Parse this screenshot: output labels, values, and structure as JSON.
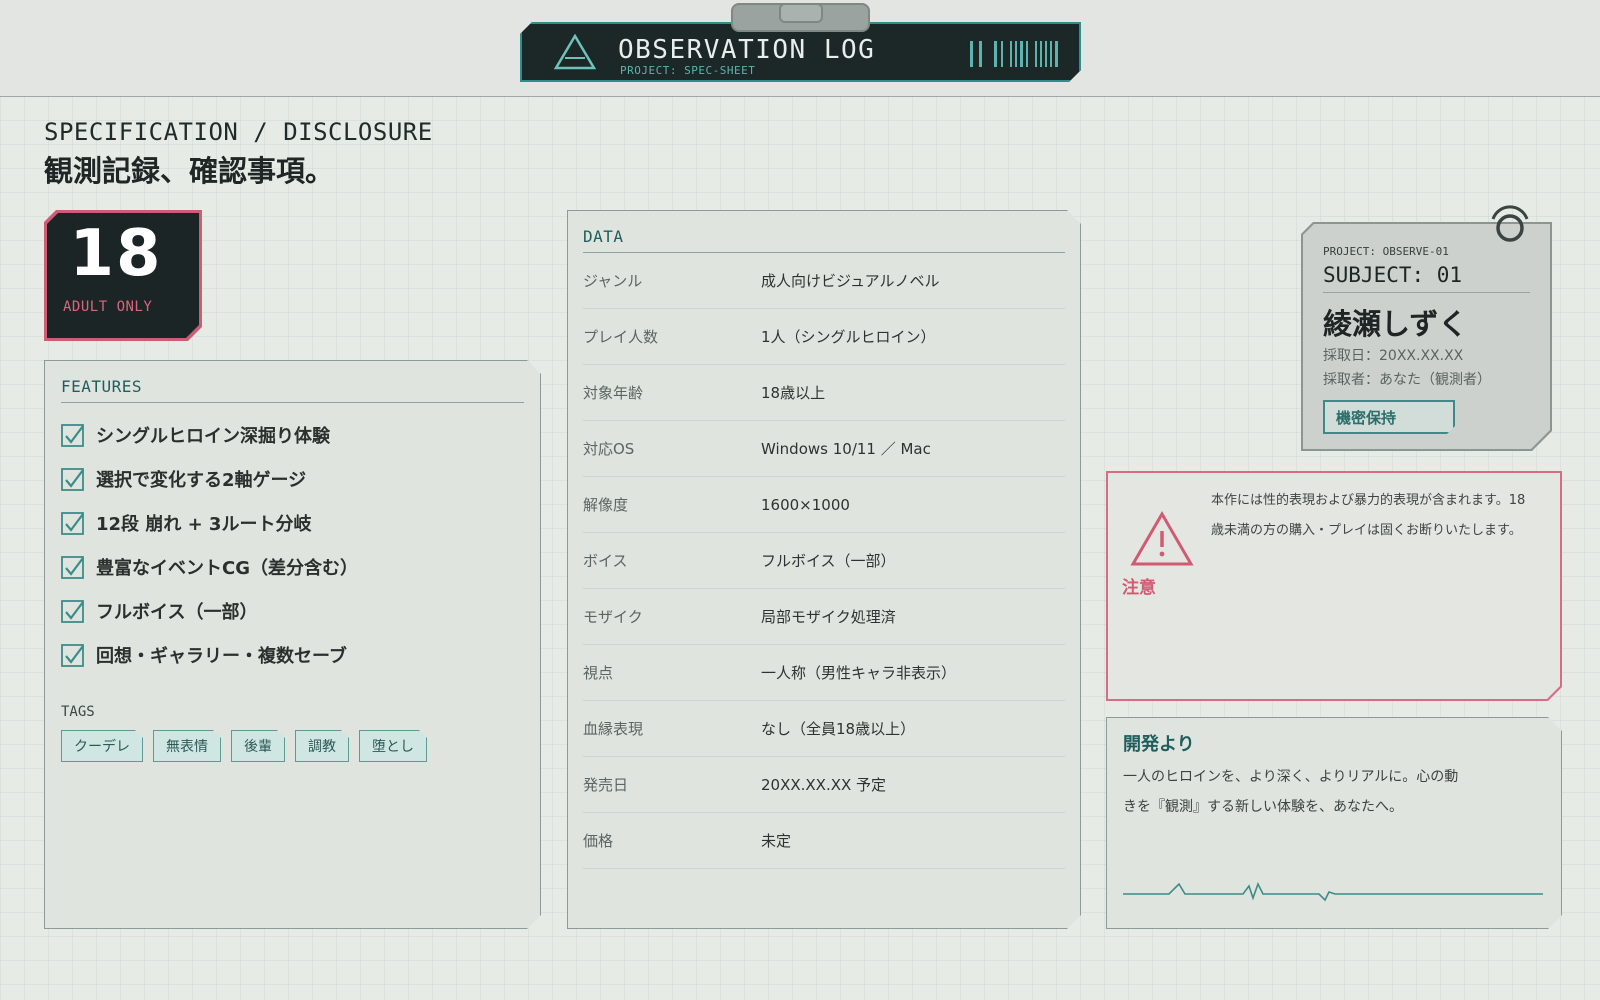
{
  "topbar": {
    "title": "OBSERVATION LOG",
    "subtitle": "PROJECT: SPEC-SHEET",
    "icons": [
      "triangle-icon",
      "barcode-icon"
    ]
  },
  "header": {
    "spec_label": "SPECIFICATION / DISCLOSURE",
    "title": "観測記録、確認事項。"
  },
  "rating": {
    "number": "18",
    "label": "ADULT ONLY"
  },
  "features": {
    "heading": "FEATURES",
    "items": [
      "シングルヒロイン深掘り体験",
      "選択で変化する2軸ゲージ",
      "12段 崩れ + 3ルート分岐",
      "豊富なイベントCG（差分含む）",
      "フルボイス（一部）",
      "回想・ギャラリー・複数セーブ"
    ],
    "tags_heading": "TAGS",
    "tags": [
      "クーデレ",
      "無表情",
      "後輩",
      "調教",
      "堕とし"
    ]
  },
  "data": {
    "heading": "DATA",
    "rows": [
      {
        "key": "ジャンル",
        "value": "成人向けビジュアルノベル"
      },
      {
        "key": "プレイ人数",
        "value": "1人（シングルヒロイン）"
      },
      {
        "key": "対象年齢",
        "value": "18歳以上"
      },
      {
        "key": "対応OS",
        "value": "Windows 10/11 ／ Mac"
      },
      {
        "key": "解像度",
        "value": "1600×1000"
      },
      {
        "key": "ボイス",
        "value": "フルボイス（一部）"
      },
      {
        "key": "モザイク",
        "value": "局部モザイク処理済"
      },
      {
        "key": "視点",
        "value": "一人称（男性キャラ非表示）"
      },
      {
        "key": "血縁表現",
        "value": "なし（全員18歳以上）"
      },
      {
        "key": "発売日",
        "value": "20XX.XX.XX 予定"
      },
      {
        "key": "価格",
        "value": "未定"
      }
    ]
  },
  "subject": {
    "project": "PROJECT: OBSERVE-01",
    "id": "SUBJECT: 01",
    "name": "綾瀬しずく",
    "date_line": "採取日：20XX.XX.XX",
    "collector_line": "採取者：あなた（観測者）",
    "badge": "機密保持"
  },
  "warning": {
    "label": "注意",
    "text": "本作には性的表現および暴力的表現が含まれます。18歳未満の方の購入・プレイは固くお断りいたします。"
  },
  "dev_message": {
    "heading": "開発より",
    "text": "一人のヒロインを、より深く、よりリアルに。心の動きを『観測』する新しい体験を、あなたへ。"
  },
  "colors": {
    "accent_teal": "#2f8f8a",
    "accent_pink": "#d25a73",
    "dark_panel": "#1c2727",
    "background": "#e6ebe6"
  }
}
